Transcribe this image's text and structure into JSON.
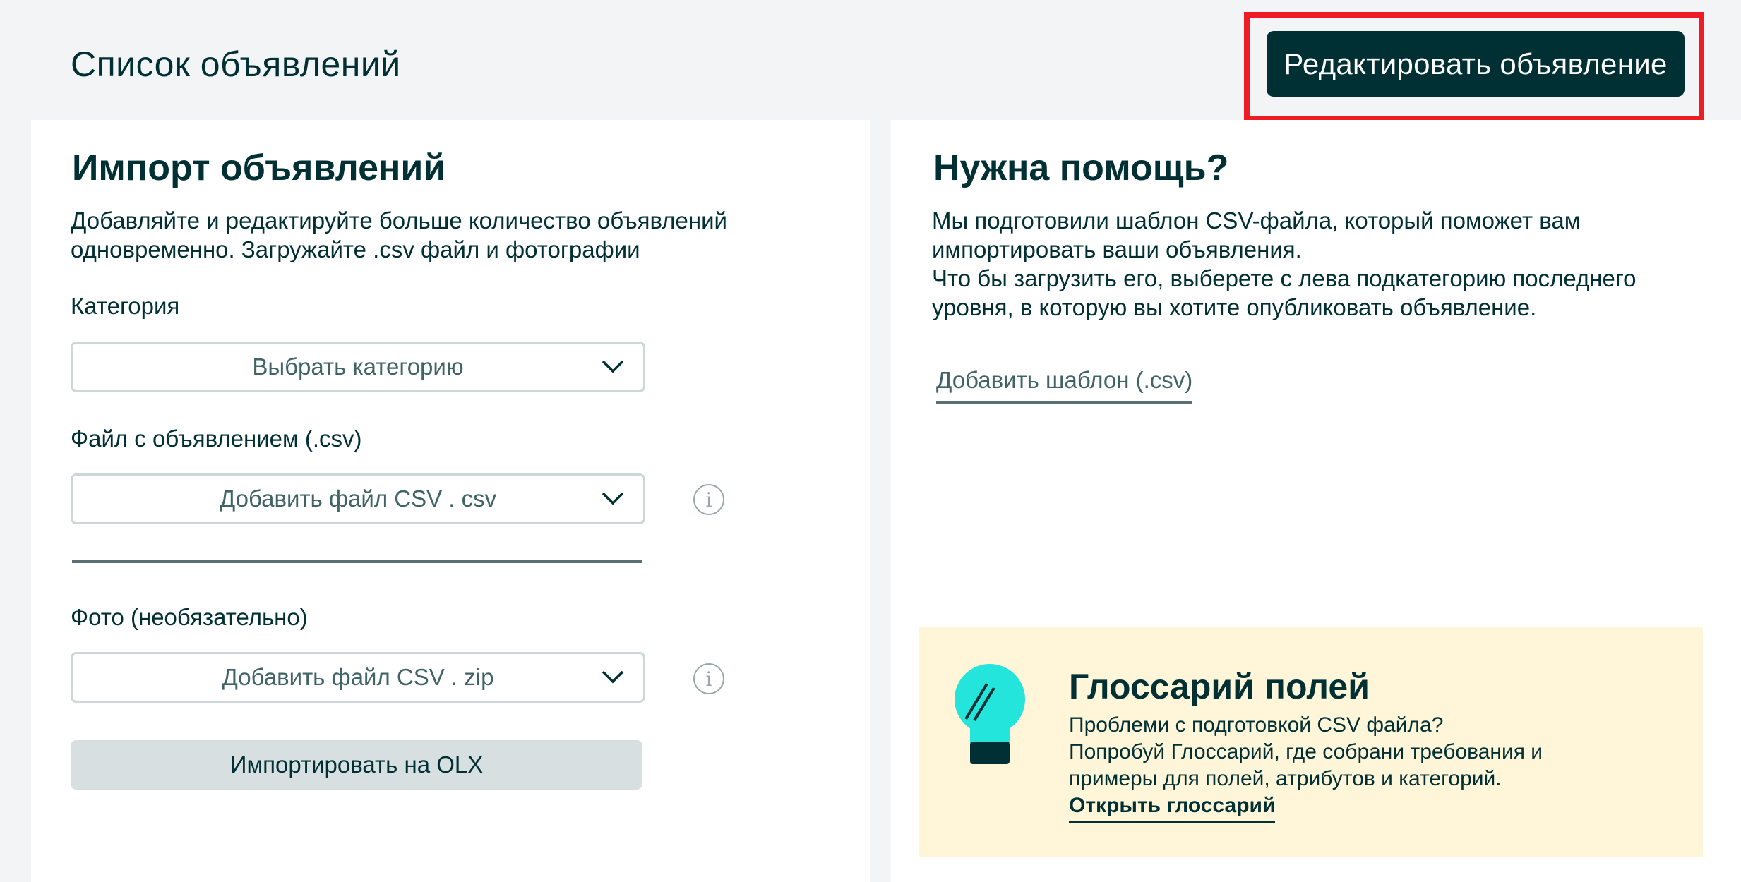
{
  "header": {
    "title": "Список объявлений",
    "edit_button": "Редактировать объявление"
  },
  "import_card": {
    "title": "Импорт объявлений",
    "description": [
      "Добавляйте и редактируйте больше количество объявлений",
      "одновременно. Загружайте .csv файл и фотографии"
    ],
    "category_label": "Категория",
    "category_select": "Выбрать категорию",
    "csv_label": "Файл с объявлением (.csv)",
    "csv_select": "Добавить файл CSV . csv",
    "photo_label": "Фото (необязательно)",
    "photo_select": "Добавить файл CSV . zip",
    "import_button": "Импортировать на OLX"
  },
  "help_card": {
    "title": "Нужна помощь?",
    "text": [
      "Мы подготовили шаблон CSV-файла, который поможет вам",
      "импортировать ваши объявления.",
      "Что бы загрузить его, выберете с лева подкатегорию последнего",
      "уровня, в которую вы хотите опубликовать объявление."
    ],
    "template_link": "Добавить шаблон (.csv)"
  },
  "glossary": {
    "title": "Глоссарий полей",
    "text": [
      "Проблеми с подготовкой CSV файла?",
      "Попробуй Глоссарий, где собрани требования и",
      "примеры для полей, атрибутов и категорий."
    ],
    "link": "Открыть глоссарий"
  },
  "colors": {
    "primary": "#002f34",
    "highlight": "#ee1c24",
    "bulb": "#23e5db",
    "glossary_bg": "#fff6d9"
  }
}
